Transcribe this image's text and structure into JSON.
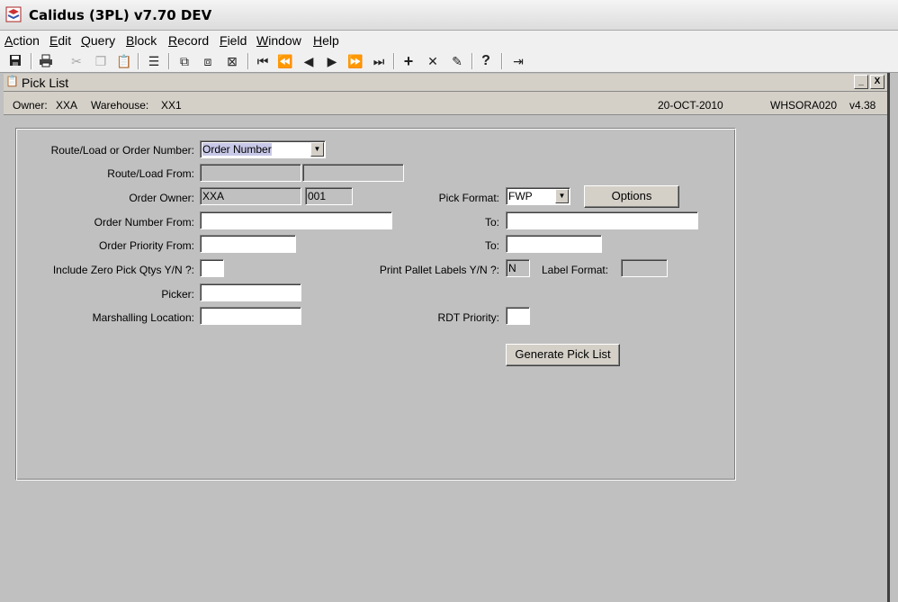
{
  "app": {
    "title": "Calidus (3PL) v7.70 DEV"
  },
  "menu": {
    "items": [
      {
        "label": "Action",
        "key": "A",
        "rest": "ction"
      },
      {
        "label": "Edit",
        "key": "E",
        "rest": "dit"
      },
      {
        "label": "Query",
        "key": "Q",
        "rest": "uery"
      },
      {
        "label": "Block",
        "key": "B",
        "rest": "lock"
      },
      {
        "label": "Record",
        "key": "R",
        "rest": "ecord"
      },
      {
        "label": "Field",
        "key": "F",
        "rest": "ield"
      },
      {
        "label": "Window",
        "key": "W",
        "rest": "indow"
      },
      {
        "label": "Help",
        "key": "H",
        "rest": "elp"
      }
    ]
  },
  "toolbar": {
    "icons": [
      "save-icon",
      "print-icon",
      "cut-icon",
      "copy-icon",
      "paste-icon",
      "clear-field-icon",
      "enter-query-icon",
      "execute-query-icon",
      "cancel-query-icon",
      "first-record-icon",
      "previous-block-icon",
      "previous-record-icon",
      "next-record-icon",
      "next-block-icon",
      "last-record-icon",
      "insert-record-icon",
      "delete-record-icon",
      "clear-record-icon",
      "help-icon",
      "exit-icon"
    ],
    "help_glyph": "?"
  },
  "window": {
    "title": "Pick List",
    "minimize": "_",
    "close": "X"
  },
  "info": {
    "owner_label": "Owner:",
    "owner_value": "XXA",
    "warehouse_label": "Warehouse:",
    "warehouse_value": "XX1",
    "date": "20-OCT-2010",
    "form_id": "WHSORA020",
    "version": "v4.38"
  },
  "form": {
    "route_or_order_label": "Route/Load or Order Number:",
    "route_or_order_value": "Order Number",
    "route_load_from_label": "Route/Load From:",
    "order_owner_label": "Order Owner:",
    "order_owner_value": "XXA",
    "order_owner_code": "001",
    "pick_format_label": "Pick Format:",
    "pick_format_value": "FWP",
    "options_button": "Options",
    "order_number_from_label": "Order Number From:",
    "order_number_to_label": "To:",
    "order_priority_from_label": "Order Priority From:",
    "order_priority_to_label": "To:",
    "include_zero_label": "Include Zero Pick Qtys Y/N ?:",
    "print_pallet_label": "Print Pallet Labels Y/N ?:",
    "print_pallet_value": "N",
    "label_format_label": "Label Format:",
    "picker_label": "Picker:",
    "marshalling_label": "Marshalling Location:",
    "rdt_priority_label": "RDT Priority:",
    "generate_button": "Generate Pick List"
  }
}
